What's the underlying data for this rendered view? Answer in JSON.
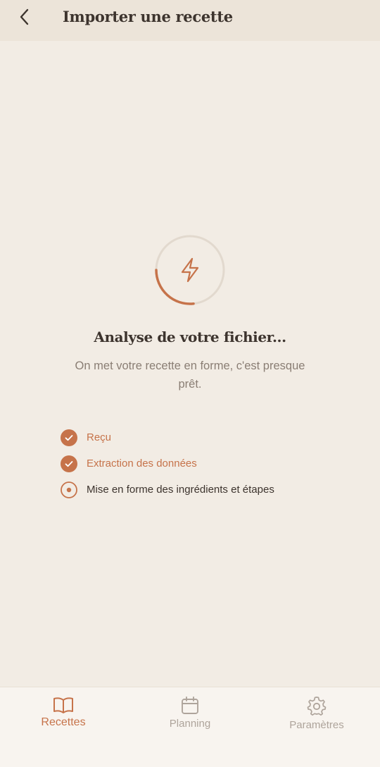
{
  "header": {
    "title": "Importer une recette"
  },
  "main": {
    "title": "Analyse de votre fichier...",
    "subtitle": "On met votre recette en forme, c'est presque prêt."
  },
  "steps": [
    {
      "label": "Reçu",
      "state": "done"
    },
    {
      "label": "Extraction des données",
      "state": "done"
    },
    {
      "label": "Mise en forme des ingrédients et étapes",
      "state": "current"
    }
  ],
  "tabs": [
    {
      "label": "Recettes",
      "icon": "book-icon",
      "active": true
    },
    {
      "label": "Planning",
      "icon": "calendar-icon",
      "active": false
    },
    {
      "label": "Paramètres",
      "icon": "gear-icon",
      "active": false
    }
  ],
  "colors": {
    "accent": "#c6734a",
    "background": "#f2ece4",
    "header": "#ece4d9",
    "muted": "#aea49b"
  }
}
